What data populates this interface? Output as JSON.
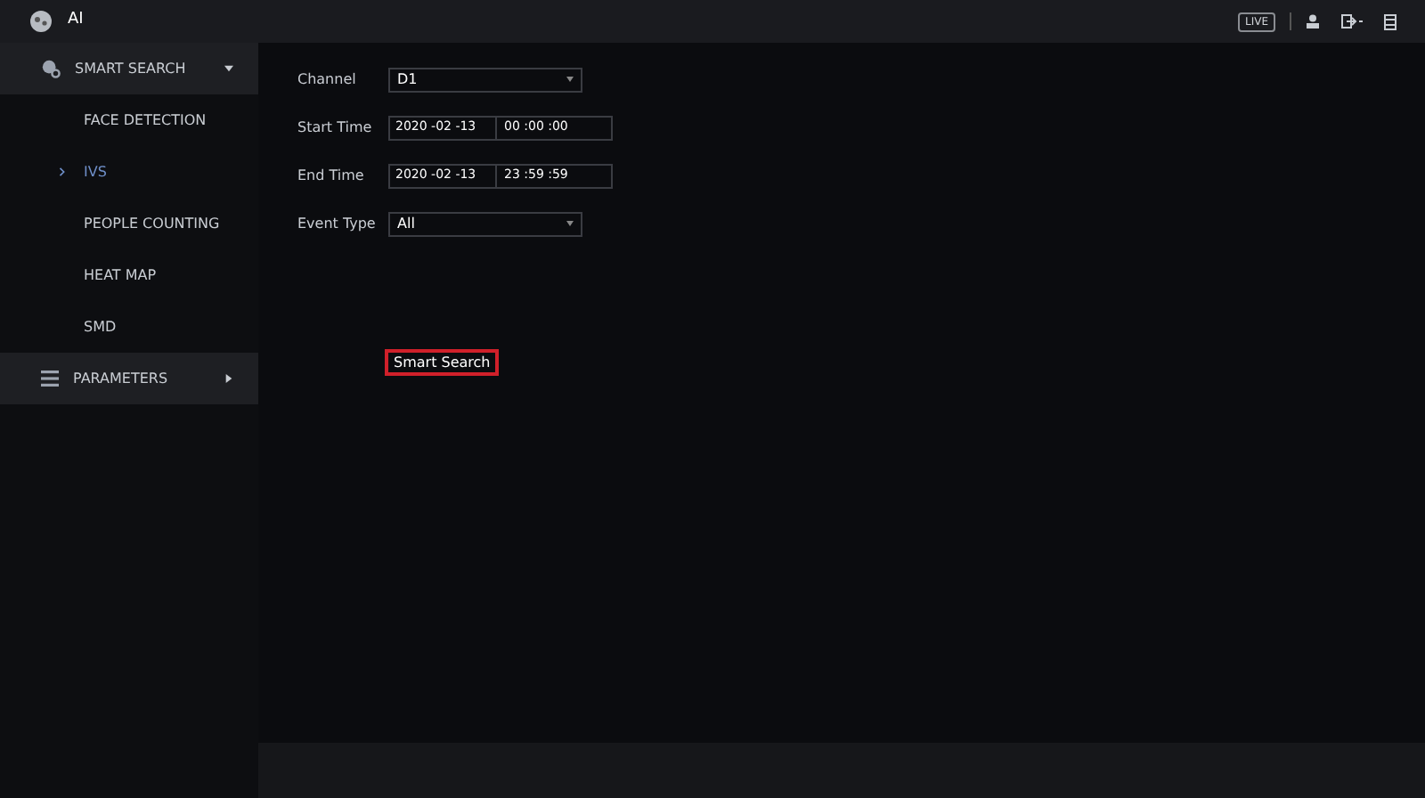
{
  "window": {
    "title": "AI",
    "live_badge": "LIVE"
  },
  "sidebar": {
    "groups": [
      {
        "label": "SMART SEARCH",
        "kind": "search",
        "expanded": true,
        "items": [
          {
            "label": "FACE DETECTION",
            "selected": false
          },
          {
            "label": "IVS",
            "selected": true
          },
          {
            "label": "PEOPLE COUNTING",
            "selected": false
          },
          {
            "label": "HEAT MAP",
            "selected": false
          },
          {
            "label": "SMD",
            "selected": false
          }
        ]
      },
      {
        "label": "PARAMETERS",
        "kind": "list",
        "expanded": false
      }
    ]
  },
  "form": {
    "fields": [
      {
        "label": "Channel",
        "kind": "dropdown",
        "value": "D1"
      },
      {
        "label": "Start Time",
        "kind": "datetime",
        "date": "2020 -02 -13",
        "time": "00 :00 :00"
      },
      {
        "label": "End Time",
        "kind": "datetime",
        "date": "2020 -02 -13",
        "time": "23 :59 :59"
      },
      {
        "label": "Event Type",
        "kind": "dropdown",
        "value": "All"
      }
    ],
    "button": "Smart Search"
  }
}
